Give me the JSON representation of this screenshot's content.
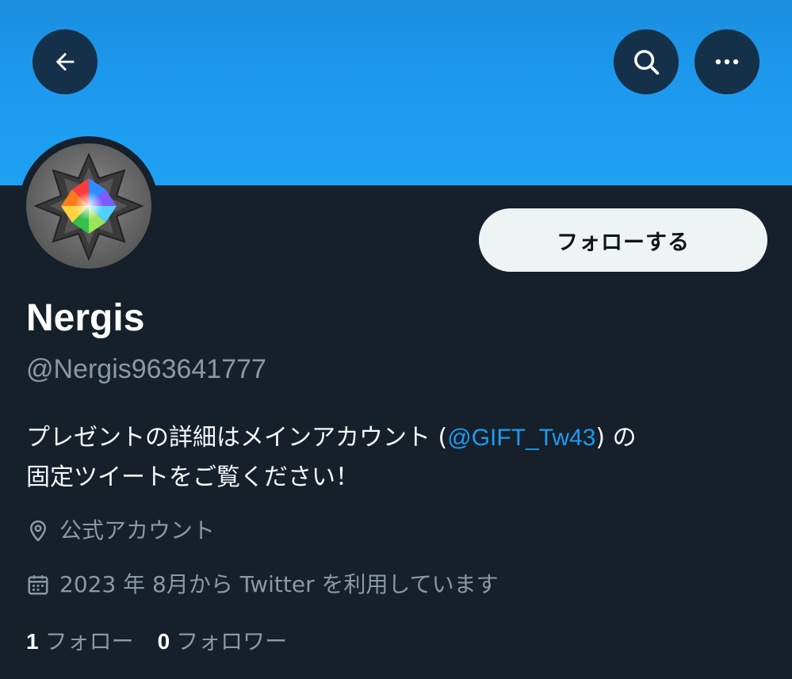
{
  "header": {
    "back_icon": "arrow-left-icon",
    "search_icon": "search-icon",
    "more_icon": "more-horizontal-icon",
    "banner_color": "#1d9bf0"
  },
  "profile": {
    "display_name": "Nergis",
    "handle": "@Nergis963641777",
    "follow_label": "フォローする",
    "bio": {
      "part1": "プレゼントの詳細はメインアカウント (",
      "mention": "@GIFT_Tw43",
      "part2": ") の",
      "line2": "固定ツイートをご覧ください！"
    },
    "location": "公式アカウント",
    "joined": "2023 年 8月から Twitter を利用しています",
    "following_count": "1",
    "following_label": "フォロー",
    "followers_count": "0",
    "followers_label": "フォロワー"
  },
  "colors": {
    "background": "#15202b",
    "accent": "#1d9bf0",
    "secondary_text": "#8b98a5"
  }
}
